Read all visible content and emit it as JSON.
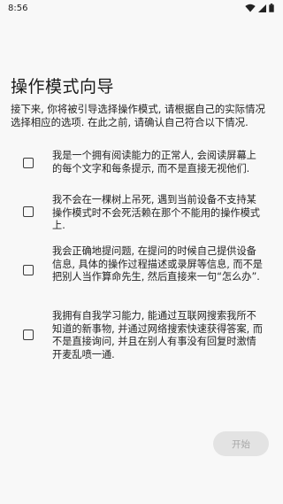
{
  "status_bar": {
    "time": "8:56"
  },
  "page": {
    "title": "操作模式向导",
    "intro": "接下来, 你将被引导选择操作模式, 请根据自己的实际情况选择相应的选项. 在此之前, 请确认自己符合以下情况."
  },
  "options": [
    {
      "label": "我是一个拥有阅读能力的正常人, 会阅读屏幕上的每个文字和每条提示, 而不是直接无视他们.",
      "checked": false
    },
    {
      "label": "我不会在一棵树上吊死, 遇到当前设备不支持某操作模式时不会死活赖在那个不能用的操作模式上.",
      "checked": false
    },
    {
      "label": "我会正确地提问题, 在提问的时候自己提供设备信息, 具体的操作过程描述或录屏等信息, 而不是把别人当作算命先生, 然后直接来一句“怎么办”.",
      "checked": false
    },
    {
      "label": "我拥有自我学习能力, 能通过互联网搜索我所不知道的新事物, 并通过网络搜索快速获得答案, 而不是直接询问, 并且在别人有事没有回复时激情开麦乱喷一通.",
      "checked": false
    }
  ],
  "actions": {
    "start_label": "开始",
    "start_enabled": false
  },
  "colors": {
    "background": "#f8f8f8",
    "disabled_button_bg": "#e3e3e3",
    "disabled_button_text": "#a8a8a8"
  },
  "icons": [
    "wifi-icon",
    "cellular-signal-icon",
    "battery-icon"
  ]
}
